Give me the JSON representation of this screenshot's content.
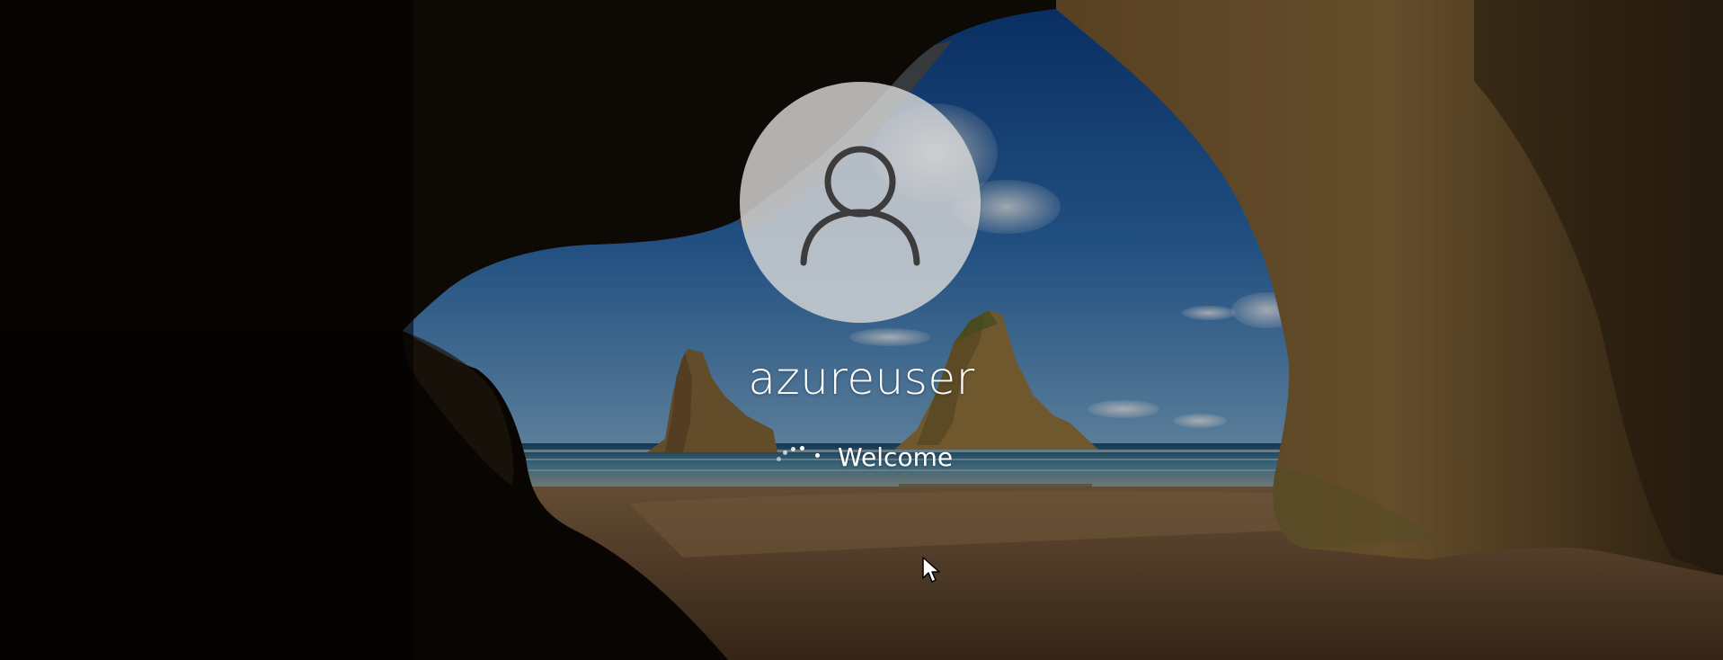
{
  "login": {
    "username": "azureuser",
    "status_text": "Welcome",
    "user_icon": "user-silhouette-icon"
  },
  "background": {
    "scene": "cave-arch-beach-wallpaper"
  },
  "pointer": {
    "icon": "mouse-pointer-icon"
  },
  "colors": {
    "text": "#ffffff",
    "avatar_bg": "#d7d7d7",
    "avatar_icon": "#3c3c3c"
  }
}
